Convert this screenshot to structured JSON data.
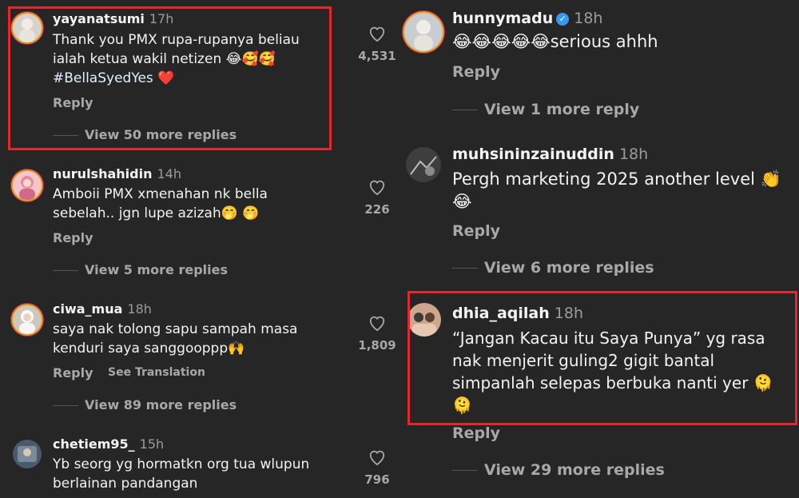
{
  "left": {
    "comments": [
      {
        "username": "yayanatsumi",
        "time": "17h",
        "lines": [
          "Thank you PMX rupa-rupanya beliau",
          "ialah ketua wakil netizen 😂🥰🥰",
          "#BellaSyedYes ❤️"
        ],
        "reply": "Reply",
        "view_replies": "View 50 more replies",
        "likes": "4,531"
      },
      {
        "username": "nurulshahidin",
        "time": "14h",
        "lines": [
          "Amboii PMX xmenahan nk bella",
          "sebelah.. jgn lupe azizah🤭 🤭"
        ],
        "reply": "Reply",
        "view_replies": "View 5 more replies",
        "likes": "226"
      },
      {
        "username": "ciwa_mua",
        "time": "18h",
        "lines": [
          "saya nak tolong sapu sampah masa",
          "kenduri saya sanggooppp🙌"
        ],
        "reply": "Reply",
        "translate": "See Translation",
        "view_replies": "View 89 more replies",
        "likes": "1,809"
      },
      {
        "username": "chetiem95_",
        "time": "15h",
        "lines": [
          "Yb seorg yg hormatkn org tua wlupun",
          "berlainan pandangan"
        ],
        "likes": "796"
      }
    ]
  },
  "right": {
    "comments": [
      {
        "username": "hunnymadu",
        "verified": true,
        "time": "18h",
        "lines": [
          "😂😂😂😂😂serious ahhh"
        ],
        "reply": "Reply",
        "view_replies": "View 1 more reply"
      },
      {
        "username": "muhsininzainuddin",
        "time": "18h",
        "lines": [
          "Pergh marketing 2025 another level 👏",
          "😂"
        ],
        "reply": "Reply",
        "view_replies": "View 6 more replies"
      },
      {
        "username": "dhia_aqilah",
        "time": "18h",
        "lines": [
          "“Jangan Kacau itu Saya Punya” yg rasa",
          "nak menjerit guling2 gigit bantal",
          "simpanlah selepas berbuka nanti yer 🫠",
          "🫠"
        ],
        "reply": "Reply",
        "view_replies": "View 29 more replies"
      }
    ]
  },
  "colors": {
    "background": "#262626",
    "highlight": "#e0282e",
    "muted": "#a8a8a8",
    "verified": "#3897f0"
  }
}
